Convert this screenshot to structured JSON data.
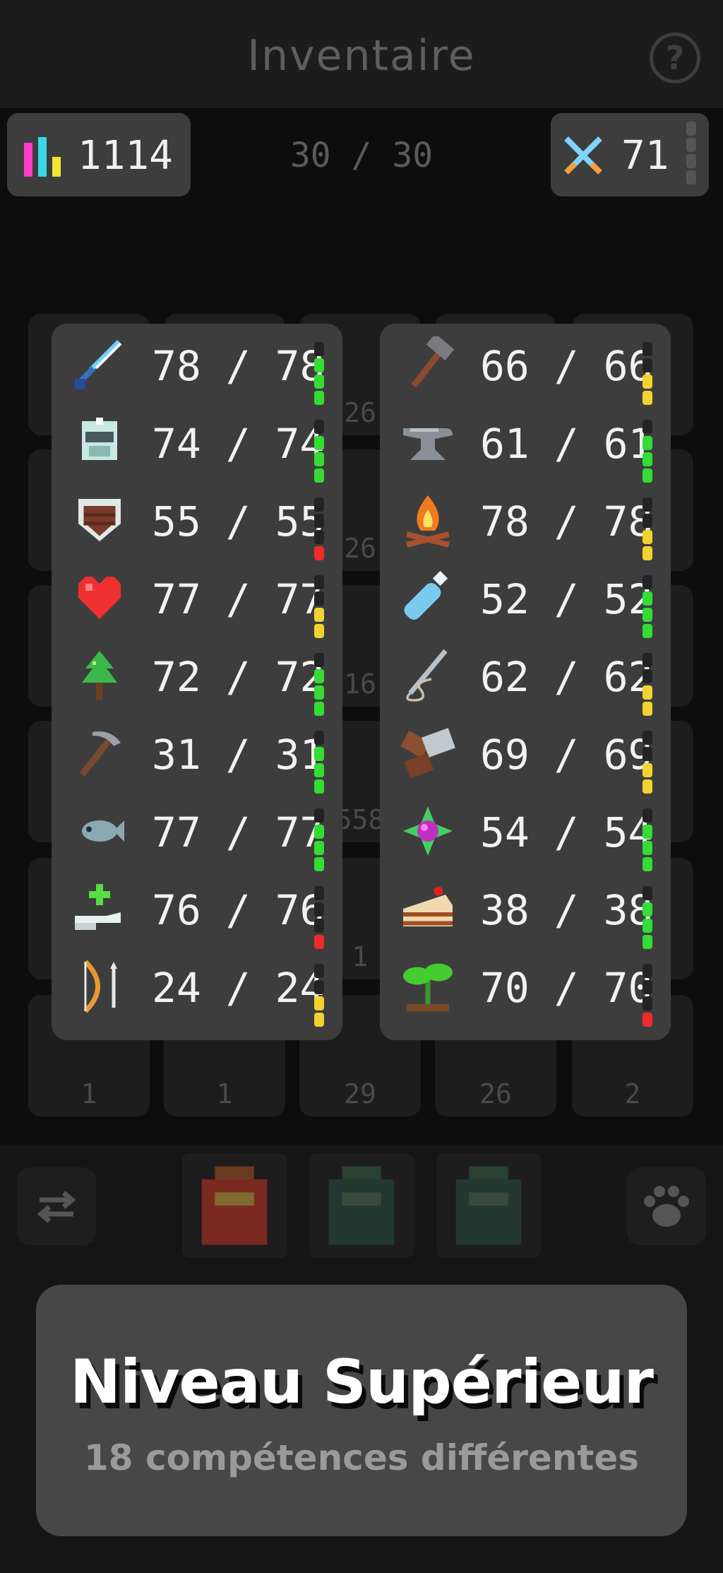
{
  "header": {
    "title": "Inventaire",
    "help_glyph": "?"
  },
  "top_stats": {
    "total_level": {
      "icon": "bar-chart-icon",
      "value": "1114"
    },
    "capacity": "30 / 30",
    "combat_level": {
      "icon": "crossed-swords-icon",
      "value": "71"
    }
  },
  "inventory_slot_counts": [
    "26",
    "26",
    "16",
    "558",
    "1",
    "1",
    "1",
    "29",
    "26",
    "2"
  ],
  "skills_left": [
    {
      "icon": "sword-icon",
      "value": "78 / 78",
      "level": "full",
      "color": "#33dd33"
    },
    {
      "icon": "helmet-icon",
      "value": "74 / 74",
      "level": "full",
      "color": "#33dd33"
    },
    {
      "icon": "shield-icon",
      "value": "55 / 55",
      "level": "low",
      "color": "#ee2a2a"
    },
    {
      "icon": "heart-icon",
      "value": "77 / 77",
      "level": "medium",
      "color": "#f2d22e"
    },
    {
      "icon": "tree-icon",
      "value": "72 / 72",
      "level": "full",
      "color": "#33dd33"
    },
    {
      "icon": "pickaxe-icon",
      "value": "31 / 31",
      "level": "full",
      "color": "#33dd33"
    },
    {
      "icon": "fish-icon",
      "value": "77 / 77",
      "level": "full",
      "color": "#33dd33"
    },
    {
      "icon": "healing-hand-icon",
      "value": "76 / 76",
      "level": "low",
      "color": "#ee2a2a"
    },
    {
      "icon": "bow-icon",
      "value": "24 / 24",
      "level": "medium",
      "color": "#f2d22e"
    }
  ],
  "skills_right": [
    {
      "icon": "hammer-icon",
      "value": "66 / 66",
      "level": "medium",
      "color": "#f2d22e"
    },
    {
      "icon": "anvil-icon",
      "value": "61 / 61",
      "level": "full",
      "color": "#33dd33"
    },
    {
      "icon": "campfire-icon",
      "value": "78 / 78",
      "level": "medium",
      "color": "#f2d22e"
    },
    {
      "icon": "potion-vial-icon",
      "value": "52 / 52",
      "level": "full",
      "color": "#33dd33"
    },
    {
      "icon": "needle-thread-icon",
      "value": "62 / 62",
      "level": "medium",
      "color": "#f2d22e"
    },
    {
      "icon": "saw-log-icon",
      "value": "69 / 69",
      "level": "medium",
      "color": "#f2d22e"
    },
    {
      "icon": "magic-gem-icon",
      "value": "54 / 54",
      "level": "full",
      "color": "#33dd33"
    },
    {
      "icon": "cake-icon",
      "value": "38 / 38",
      "level": "full",
      "color": "#33dd33"
    },
    {
      "icon": "sprout-icon",
      "value": "70 / 70",
      "level": "low",
      "color": "#ee2a2a"
    }
  ],
  "bottom_bar": {
    "swap_icon": "swap-arrows-icon",
    "paw_icon": "paw-icon",
    "bags": [
      "red-bag-icon",
      "green-bag-icon",
      "green-bag-icon"
    ]
  },
  "banner": {
    "title": "Niveau Supérieur",
    "subtitle": "18 compétences différentes"
  },
  "colors": {
    "background": "#0d0d0d",
    "panel": "#3d3d3d",
    "banner": "#474747",
    "green": "#33dd33",
    "yellow": "#f2d22e",
    "red": "#ee2a2a"
  }
}
